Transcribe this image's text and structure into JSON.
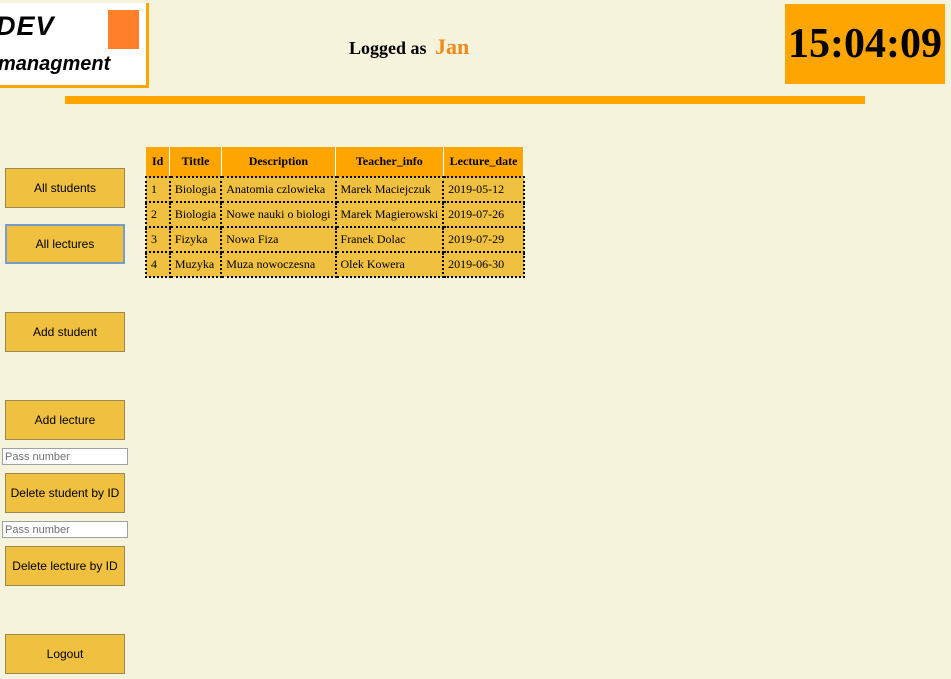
{
  "logo": {
    "line1": "DEV",
    "line2": "managment",
    "square_color": "#ff7f2a"
  },
  "header": {
    "logged_prefix": "Logged as",
    "username": "Jan",
    "clock": "15:04:09"
  },
  "colors": {
    "accent": "#ffa500",
    "button": "#f0c040",
    "background": "#f5f3dc",
    "username": "#f0891a"
  },
  "sidebar": {
    "all_students": "All students",
    "all_lectures": "All lectures",
    "add_student": "Add student",
    "add_lecture": "Add lecture",
    "delete_student_placeholder": "Pass number",
    "delete_student": "Delete student by ID",
    "delete_lecture_placeholder": "Pass number",
    "delete_lecture": "Delete lecture by ID",
    "logout": "Logout"
  },
  "table": {
    "headers": [
      "Id",
      "Tittle",
      "Description",
      "Teacher_info",
      "Lecture_date"
    ],
    "rows": [
      [
        "1",
        "Biologia",
        "Anatomia czlowieka",
        "Marek Maciejczuk",
        "2019-05-12"
      ],
      [
        "2",
        "Biologia",
        "Nowe nauki o biologi",
        "Marek Magierowski",
        "2019-07-26"
      ],
      [
        "3",
        "Fizyka",
        "Nowa Fiza",
        "Franek Dolac",
        "2019-07-29"
      ],
      [
        "4",
        "Muzyka",
        "Muza nowoczesna",
        "Olek Kowera",
        "2019-06-30"
      ]
    ]
  }
}
